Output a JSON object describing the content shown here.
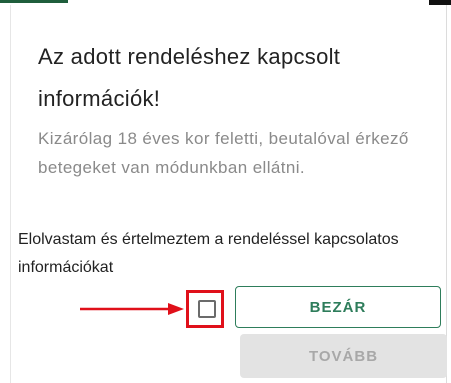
{
  "dialog": {
    "title": "Az adott rendeléshez kapcsolt információk!",
    "description": "Kizárólag 18 éves kor feletti, beutalóval érkező betegeket van módunkban ellátni.",
    "consent_label": "Elolvastam és értelmeztem a rendeléssel kapcsolatos információkat",
    "consent_checked": false,
    "buttons": {
      "close_label": "BEZÁR",
      "next_label": "TOVÁBB"
    }
  },
  "annotation": {
    "arrow_icon": "arrow-right-icon",
    "highlight_color": "#e0101a"
  },
  "colors": {
    "accent": "#2e7d5b",
    "disabled_bg": "#e3e3e3",
    "disabled_text": "#a8a8a8"
  }
}
